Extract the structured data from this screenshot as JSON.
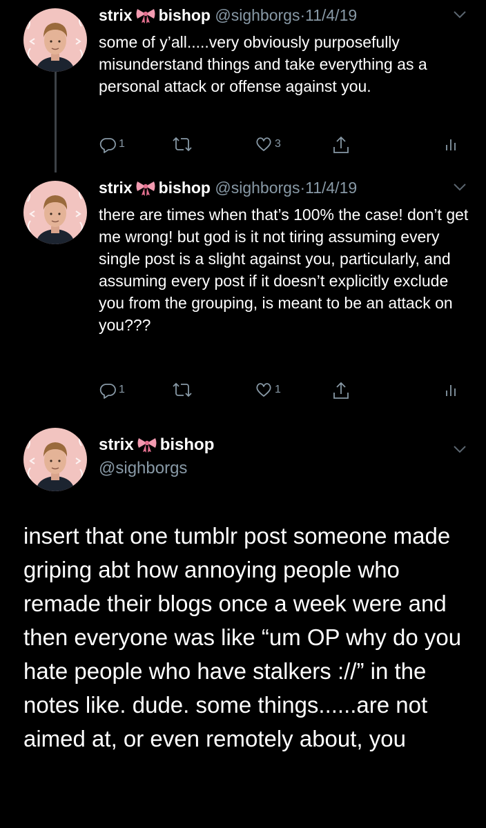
{
  "tweets": [
    {
      "display_name_1": "strix",
      "display_name_2": "bishop",
      "handle": "@sighborgs",
      "separator": "·",
      "date": "11/4/19",
      "text": "some of y’all.....very obviously purposefully misunderstand things and take everything as a personal attack or offense against you.",
      "reply_count": "1",
      "retweet_count": "",
      "like_count": "3"
    },
    {
      "display_name_1": "strix",
      "display_name_2": "bishop",
      "handle": "@sighborgs",
      "separator": "·",
      "date": "11/4/19",
      "text": "there are times when that’s 100% the case! don’t get me wrong! but god is it not tiring assuming every single post is a slight against you, particularly, and assuming every post if it doesn’t explicitly exclude you from the grouping, is meant to be an attack on you???",
      "reply_count": "1",
      "retweet_count": "",
      "like_count": "1"
    }
  ],
  "main_tweet": {
    "display_name_1": "strix",
    "display_name_2": "bishop",
    "handle": "@sighborgs",
    "text": "insert that one tumblr post someone made griping abt how annoying people who remade their blogs once a week were and then everyone was like “um OP why do you hate people who have stalkers ://” in the notes like. dude. some things......are not aimed at, or even remotely about, you"
  },
  "icons": {
    "reply": "reply-icon",
    "retweet": "retweet-icon",
    "like": "heart-icon",
    "share": "share-icon",
    "analytics": "analytics-icon",
    "menu": "chevron-down-icon",
    "emoji": "ribbon-bow-icon"
  },
  "colors": {
    "background": "#000000",
    "text": "#ffffff",
    "muted": "#8899a6",
    "thread_line": "#3d4247",
    "avatar_bg": "#f2c4c0",
    "bow": "#f29ab0"
  }
}
